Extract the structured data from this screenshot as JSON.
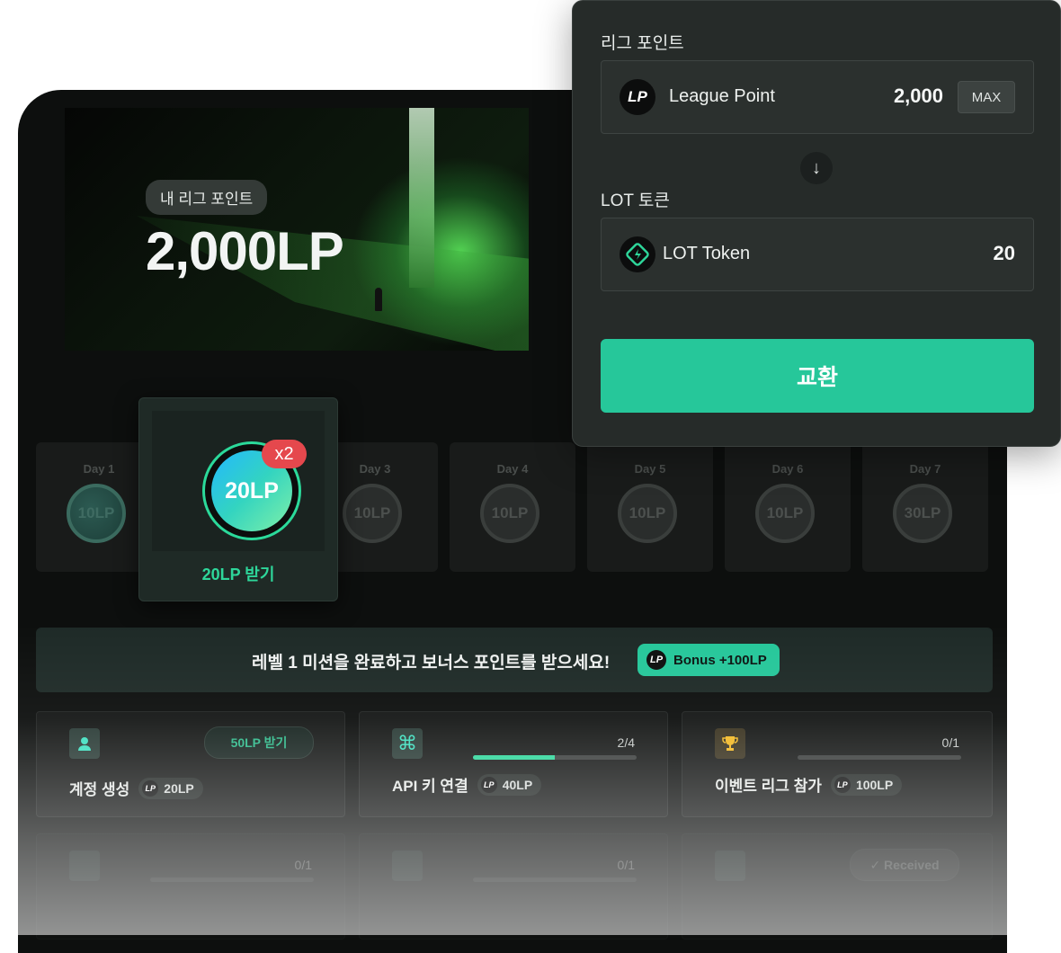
{
  "hero": {
    "label": "내 리그 포인트",
    "points": "2,000LP"
  },
  "days": [
    {
      "label": "Day 1",
      "reward": "10LP",
      "claimed": true
    },
    {
      "label": "Day 3",
      "reward": "10LP"
    },
    {
      "label": "Day 4",
      "reward": "10LP"
    },
    {
      "label": "Day 5",
      "reward": "10LP"
    },
    {
      "label": "Day 6",
      "reward": "10LP"
    },
    {
      "label": "Day 7",
      "reward": "30LP"
    }
  ],
  "active_day": {
    "reward": "20LP",
    "multiplier": "x2",
    "claim_label": "20LP 받기"
  },
  "banner": {
    "text": "레벨 1 미션을 완료하고 보너스 포인트를 받으세요!",
    "bonus": "Bonus +100LP"
  },
  "tasks": [
    {
      "name": "계정 생성",
      "reward": "20LP",
      "button": "50LP 받기",
      "icon": "user-icon"
    },
    {
      "name": "API 키 연결",
      "reward": "40LP",
      "progress": "2/4",
      "progress_fraction": 0.5,
      "icon": "command-icon"
    },
    {
      "name": "이벤트 리그 참가",
      "reward": "100LP",
      "progress": "0/1",
      "progress_fraction": 0,
      "icon": "trophy-icon"
    }
  ],
  "ghost_tasks": [
    {
      "progress": "0/1"
    },
    {
      "progress": "0/1"
    },
    {
      "button": "✓ Received"
    }
  ],
  "exchange": {
    "from_label": "리그 포인트",
    "from_name": "League Point",
    "from_value": "2,000",
    "max_label": "MAX",
    "to_label": "LOT 토큰",
    "to_name": "LOT Token",
    "to_value": "20",
    "button": "교환",
    "accent": "#26c79a"
  }
}
